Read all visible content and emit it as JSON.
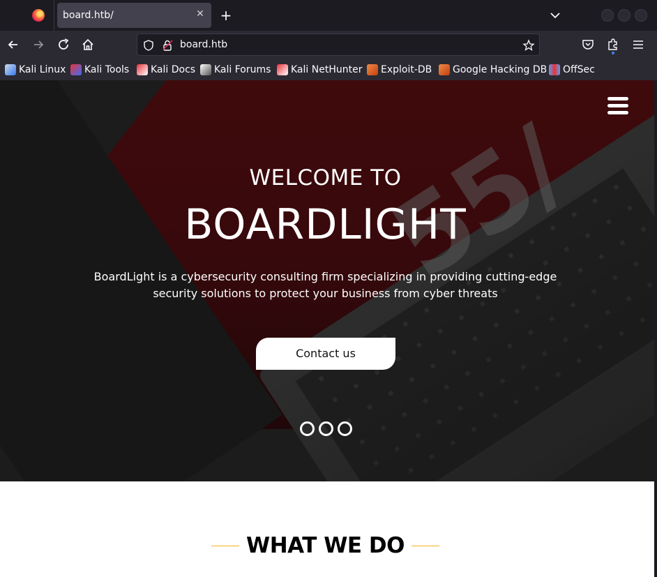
{
  "browser": {
    "tab": {
      "title": "board.htb/"
    },
    "url": "board.htb",
    "bookmarks": [
      {
        "label": "Kali Linux",
        "icon": "kali-dragon-icon",
        "color": "#367bf0"
      },
      {
        "label": "Kali Tools",
        "icon": "kali-tools-icon",
        "color": "#3b6ef5"
      },
      {
        "label": "Kali Docs",
        "icon": "kali-docs-icon",
        "color": "#e8333a"
      },
      {
        "label": "Kali Forums",
        "icon": "kali-forums-icon",
        "color": "#cfcfcf"
      },
      {
        "label": "Kali NetHunter",
        "icon": "kali-nethunter-icon",
        "color": "#e8333a"
      },
      {
        "label": "Exploit-DB",
        "icon": "exploit-db-icon",
        "color": "#e8622c"
      },
      {
        "label": "Google Hacking DB",
        "icon": "ghdb-icon",
        "color": "#e8622c"
      },
      {
        "label": "OffSec",
        "icon": "offsec-icon",
        "color": "#5aa0f0"
      }
    ]
  },
  "hero": {
    "welcome": "WELCOME TO",
    "brand": "BOARDLIGHT",
    "description": "BoardLight is a cybersecurity consulting firm specializing in providing cutting-edge security solutions to protect your business from cyber threats",
    "contact_label": "Contact us",
    "sticker_text": "55/",
    "slide_count": 3
  },
  "section": {
    "title": "WHAT WE DO",
    "accent": "#f5b021"
  }
}
